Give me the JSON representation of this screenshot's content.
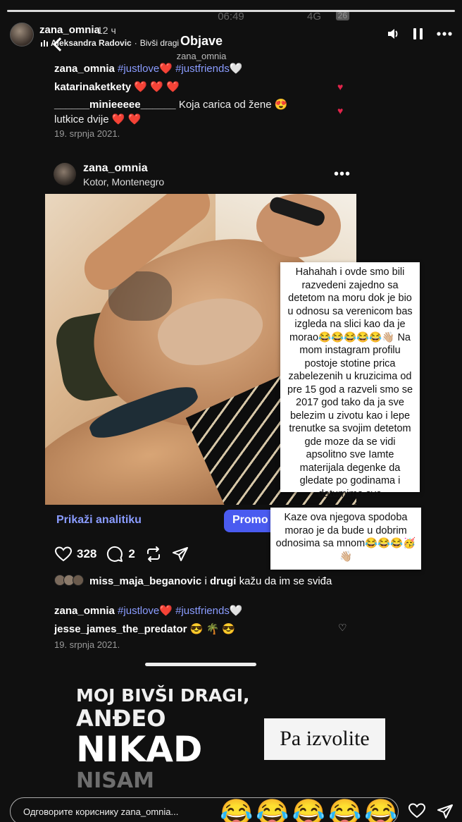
{
  "story": {
    "username": "zana_omnia",
    "time_ago": "12 ч",
    "music_artist": "Aleksandra Radovic",
    "music_song": "Bivši dragi",
    "status_time": "06:49",
    "status_network": "4G",
    "status_battery": "26",
    "reply_placeholder": "Одговорите кориснику zana_omnia...",
    "reaction_emojis": [
      "😂",
      "😂",
      "😂",
      "😂",
      "😂"
    ]
  },
  "screenshot": {
    "nav_title": "Objave",
    "nav_subtitle": "zana_omnia",
    "prev_post": {
      "caption_user": "zana_omnia",
      "caption_tags": "#justlove",
      "caption_heart": "❤️",
      "caption_tags2": "#justfriends",
      "caption_heart2": "🤍",
      "comments": [
        {
          "user": "katarinaketkety",
          "text": "❤️ ❤️ ❤️"
        },
        {
          "user": "______minieeeee______",
          "text": "Koja carica od žene 😍 lutkice dvije ❤️ ❤️"
        }
      ],
      "date": "19. srpnja 2021."
    },
    "post": {
      "username": "zana_omnia",
      "location": "Kotor, Montenegro",
      "analytics_label": "Prikaži analitiku",
      "promote_label": "Promo",
      "likes": "328",
      "comments": "2",
      "liked_by_user": "miss_maja_beganovic",
      "liked_by_and": "i",
      "liked_by_others": "drugi",
      "liked_by_suffix": "kažu da im se sviđa",
      "caption_user": "zana_omnia",
      "caption_tags": "#justlove",
      "caption_heart": "❤️",
      "caption_tags2": "#justfriends",
      "caption_heart2": "🤍",
      "comment_user": "jesse_james_the_predator",
      "comment_text": "😎 🌴 😎",
      "date": "19. srpnja 2021."
    }
  },
  "notes": {
    "note1": "Hahahah i ovde smo bili\nrazvedeni zajedno sa\ndetetom na moru dok je bio\nu odnosu sa verenicom bas\nizgleda na slici kao da je\nmorao😂😂😂😂😂👋🏼 Na\nmom instagram profilu\npostoje stotine prica\nzabelezenih u kruzicima od\npre 15 god a razveli smo se\n2017 god tako da ja sve\nbelezim u zivotu kao i lepe\ntrenutke sa svojim detetom\ngde moze da se vidi\napsolitno sve Iamte\nmaterijala degenke da\ngledate po godinama i\ndatumima sve",
    "note2": "Kaze ova njegova spodoba\nmorao je da bude u dobrim\nodnosima sa mnom😂😂😂🥳\n👋🏼"
  },
  "promo_text": {
    "line1": "MOJ BIVŠI DRAGI,",
    "line2": "ANĐEO",
    "line3": "NIKAD",
    "line4": "NISAM"
  },
  "sticker": "Pa izvolite",
  "colors": {
    "tag": "#8a9cff",
    "heart": "#e0244a",
    "promote": "#4a5bf0"
  }
}
